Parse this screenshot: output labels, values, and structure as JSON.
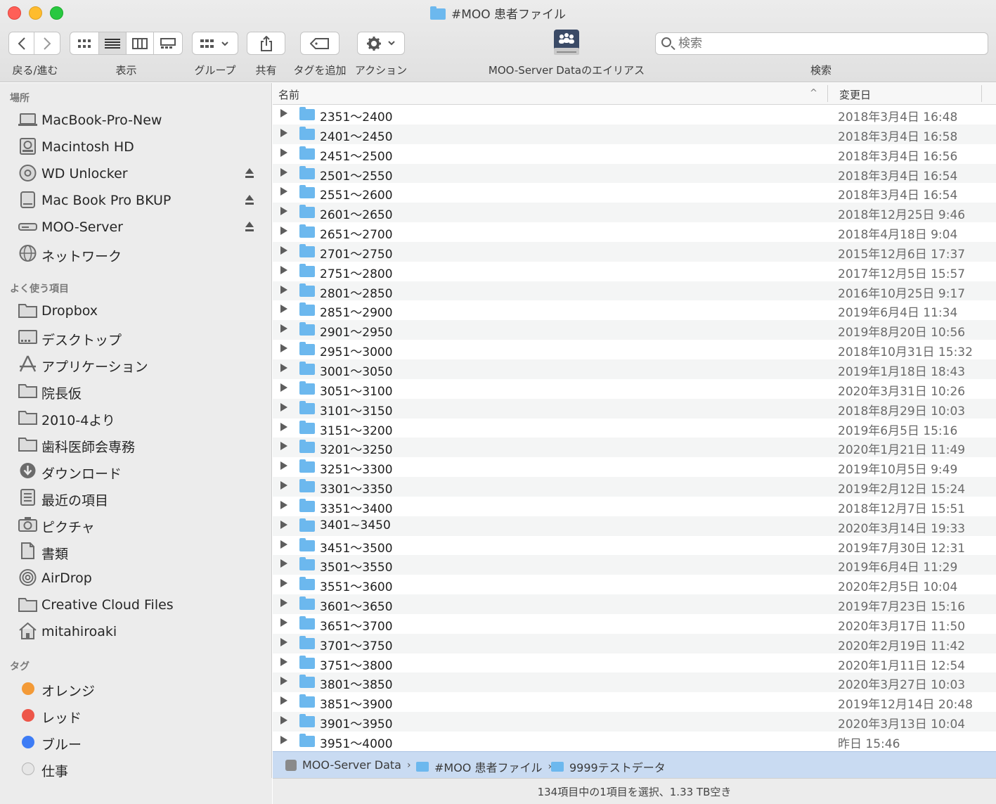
{
  "window": {
    "title": "#MOO 患者ファイル"
  },
  "toolbar": {
    "back_forward_label": "戻る/進む",
    "view_label": "表示",
    "group_label": "グループ",
    "share_label": "共有",
    "tag_label": "タグを追加",
    "action_label": "アクション",
    "alias_label": "MOO-Server Dataのエイリアス",
    "search_label": "検索",
    "search_placeholder": "検索"
  },
  "sidebar": {
    "places_heading": "場所",
    "places": [
      {
        "label": "MacBook-Pro-New",
        "icon": "laptop-icon"
      },
      {
        "label": "Macintosh HD",
        "icon": "hard-disk-icon"
      },
      {
        "label": "WD Unlocker",
        "icon": "disc-icon",
        "eject": true
      },
      {
        "label": "Mac Book Pro BKUP",
        "icon": "external-drive-icon",
        "eject": true
      },
      {
        "label": "MOO-Server",
        "icon": "server-icon",
        "eject": true
      },
      {
        "label": "ネットワーク",
        "icon": "network-globe-icon"
      }
    ],
    "favorites_heading": "よく使う項目",
    "favorites": [
      {
        "label": "Dropbox",
        "icon": "folder-icon"
      },
      {
        "label": "デスクトップ",
        "icon": "desktop-icon"
      },
      {
        "label": "アプリケーション",
        "icon": "applications-icon"
      },
      {
        "label": "院長仮",
        "icon": "folder-icon"
      },
      {
        "label": "2010-4より",
        "icon": "folder-icon"
      },
      {
        "label": "歯科医師会専務",
        "icon": "folder-icon"
      },
      {
        "label": "ダウンロード",
        "icon": "download-icon"
      },
      {
        "label": "最近の項目",
        "icon": "recents-icon"
      },
      {
        "label": "ピクチャ",
        "icon": "camera-icon"
      },
      {
        "label": "書類",
        "icon": "document-icon"
      },
      {
        "label": "AirDrop",
        "icon": "airdrop-icon"
      },
      {
        "label": "Creative Cloud Files",
        "icon": "folder-icon"
      },
      {
        "label": "mitahiroaki",
        "icon": "home-icon"
      }
    ],
    "tags_heading": "タグ",
    "tags": [
      {
        "label": "オレンジ",
        "color": "#f39a37"
      },
      {
        "label": "レッド",
        "color": "#ed5649"
      },
      {
        "label": "ブルー",
        "color": "#3d7cf5"
      },
      {
        "label": "仕事",
        "color": "#e6e6e6"
      }
    ]
  },
  "list": {
    "col_name": "名前",
    "col_date": "変更日",
    "rows": [
      {
        "name": "2351〜2400",
        "date": "2018年3月4日 16:48"
      },
      {
        "name": "2401〜2450",
        "date": "2018年3月4日 16:58"
      },
      {
        "name": "2451〜2500",
        "date": "2018年3月4日 16:56"
      },
      {
        "name": "2501〜2550",
        "date": "2018年3月4日 16:54"
      },
      {
        "name": "2551〜2600",
        "date": "2018年3月4日 16:54"
      },
      {
        "name": "2601〜2650",
        "date": "2018年12月25日 9:46"
      },
      {
        "name": "2651〜2700",
        "date": "2018年4月18日 9:04"
      },
      {
        "name": "2701〜2750",
        "date": "2015年12月6日 17:37"
      },
      {
        "name": "2751〜2800",
        "date": "2017年12月5日 15:57"
      },
      {
        "name": "2801〜2850",
        "date": "2016年10月25日 9:17"
      },
      {
        "name": "2851〜2900",
        "date": "2019年6月4日 11:34"
      },
      {
        "name": "2901〜2950",
        "date": "2019年8月20日 10:56"
      },
      {
        "name": "2951〜3000",
        "date": "2018年10月31日 15:32"
      },
      {
        "name": "3001〜3050",
        "date": "2019年1月18日 18:43"
      },
      {
        "name": "3051〜3100",
        "date": "2020年3月31日 10:26"
      },
      {
        "name": "3101〜3150",
        "date": "2018年8月29日 10:03"
      },
      {
        "name": "3151〜3200",
        "date": "2019年6月5日 15:16"
      },
      {
        "name": "3201〜3250",
        "date": "2020年1月21日 11:49"
      },
      {
        "name": "3251〜3300",
        "date": "2019年10月5日 9:49"
      },
      {
        "name": "3301〜3350",
        "date": "2019年2月12日 15:24"
      },
      {
        "name": "3351〜3400",
        "date": "2018年12月7日 15:51"
      },
      {
        "name": "3401~3450",
        "date": "2020年3月14日 19:33"
      },
      {
        "name": "3451〜3500",
        "date": "2019年7月30日 12:31"
      },
      {
        "name": "3501〜3550",
        "date": "2019年6月4日 11:29"
      },
      {
        "name": "3551〜3600",
        "date": "2020年2月5日 10:04"
      },
      {
        "name": "3601〜3650",
        "date": "2019年7月23日 15:16"
      },
      {
        "name": "3651〜3700",
        "date": "2020年3月17日 11:50"
      },
      {
        "name": "3701〜3750",
        "date": "2020年2月19日 11:42"
      },
      {
        "name": "3751〜3800",
        "date": "2020年1月11日 12:54"
      },
      {
        "name": "3801〜3850",
        "date": "2020年3月27日 10:03"
      },
      {
        "name": "3851〜3900",
        "date": "2019年12月14日 20:48"
      },
      {
        "name": "3901〜3950",
        "date": "2020年3月13日 10:04"
      },
      {
        "name": "3951〜4000",
        "date": "昨日 15:46"
      }
    ]
  },
  "pathbar": {
    "crumbs": [
      "MOO-Server Data",
      "#MOO 患者ファイル",
      "9999テストデータ"
    ]
  },
  "status": {
    "text": "134項目中の1項目を選択、1.33 TB空き"
  }
}
